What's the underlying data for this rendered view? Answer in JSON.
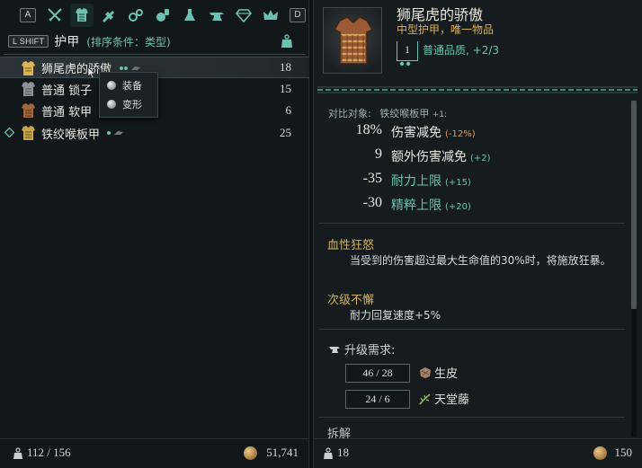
{
  "colors": {
    "accent_teal": "#6cc1b2",
    "gold": "#dcb14d",
    "orange": "#e09a4a",
    "panel": "#121719"
  },
  "tabbar": {
    "prev_key": "A",
    "next_key": "D",
    "icons": [
      "swords-icon",
      "armor-icon",
      "crafting-icon",
      "jewelry-icon",
      "consumables-icon",
      "alchemy-icon",
      "anvil-icon",
      "gem-icon",
      "crown-icon"
    ],
    "active_index": 1
  },
  "subbar": {
    "shift_key": "L SHIFT",
    "category": "护甲",
    "sort_label": "(排序条件：类型)"
  },
  "items": [
    {
      "name": "狮尾虎的骄傲",
      "count": "18",
      "selected": true,
      "icon": "gold-armor-icon"
    },
    {
      "name": "普通 锁子",
      "count": "15",
      "selected": false,
      "icon": "chainmail-icon"
    },
    {
      "name": "普通 软甲",
      "count": "6",
      "selected": false,
      "icon": "leather-armor-icon"
    },
    {
      "name": "铁绞喉板甲",
      "count": "25",
      "selected": false,
      "icon": "plate-armor-icon",
      "pinned": true
    }
  ],
  "context_menu": {
    "options": [
      "装备",
      "变形"
    ]
  },
  "left_footer": {
    "weight": "112 / 156",
    "money": "51,741"
  },
  "detail": {
    "title": "狮尾虎的骄傲",
    "subtitle": "中型护甲，唯一物品",
    "tier": "1",
    "quality": "普通品质",
    "quality_progress": "+2/3",
    "compare_label": "对比对象:",
    "compare_item": "铁绞喉板甲",
    "compare_tier": "+1:",
    "stats": [
      {
        "value": "18%",
        "name": "伤害减免",
        "delta": "(-12%)",
        "delta_color": "orange",
        "name_teal": false
      },
      {
        "value": "9",
        "name": "额外伤害减免",
        "delta": "(+2)",
        "delta_color": "teal",
        "name_teal": false
      },
      {
        "value": "-35",
        "name": "耐力上限",
        "delta": "(+15)",
        "delta_color": "teal",
        "name_teal": true
      },
      {
        "value": "-30",
        "name": "精粹上限",
        "delta": "(+20)",
        "delta_color": "teal",
        "name_teal": true
      }
    ],
    "perks": [
      {
        "title": "血性狂怒",
        "desc": "当受到的伤害超过最大生命值的30%时，将施放狂暴。"
      },
      {
        "title": "次级不懈",
        "desc": "耐力回复速度+5%"
      }
    ],
    "upgrade_title": "升级需求:",
    "materials": [
      {
        "have": "46 / 28",
        "name": "生皮",
        "icon": "hide-icon"
      },
      {
        "have": "24 / 6",
        "name": "天堂藤",
        "icon": "vine-icon"
      }
    ],
    "dismantle": "拆解"
  },
  "right_footer": {
    "weight": "18",
    "money": "150"
  }
}
